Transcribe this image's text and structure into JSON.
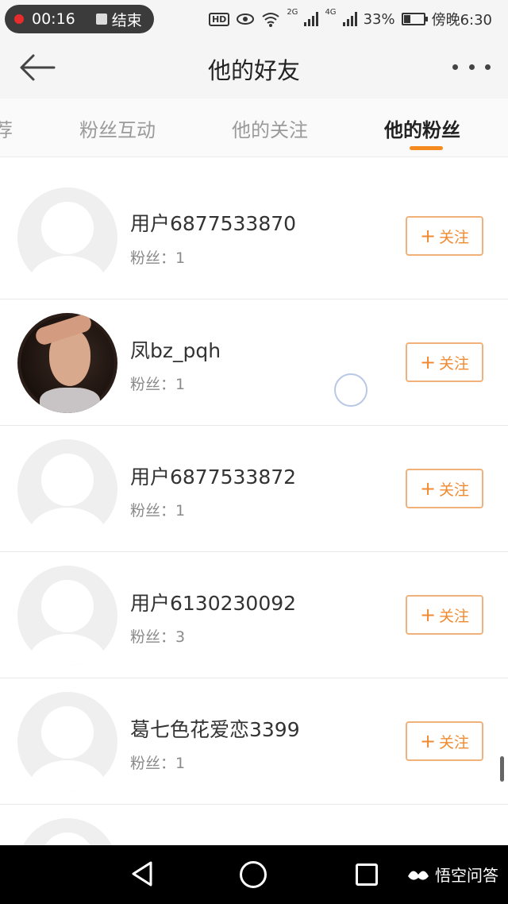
{
  "status_bar": {
    "record_time": "00:16",
    "record_end": "结束",
    "hd": "HD",
    "net_2g": "2G",
    "net_4g": "4G",
    "battery_percent": "33%",
    "battery_level": 0.33,
    "clock": "傍晚6:30"
  },
  "nav": {
    "title": "他的好友"
  },
  "tabs": [
    {
      "label": "荐",
      "active": false
    },
    {
      "label": "粉丝互动",
      "active": false
    },
    {
      "label": "他的关注",
      "active": false
    },
    {
      "label": "他的粉丝",
      "active": true
    }
  ],
  "users": [
    {
      "name": "用户6877533870",
      "fans_label": "粉丝：1",
      "avatar": "default-avatar",
      "follow_label": "关注"
    },
    {
      "name": "凤bz_pqh",
      "fans_label": "粉丝：1",
      "avatar": "photo-avatar",
      "follow_label": "关注"
    },
    {
      "name": "用户6877533872",
      "fans_label": "粉丝：1",
      "avatar": "default-avatar",
      "follow_label": "关注"
    },
    {
      "name": "用户6130230092",
      "fans_label": "粉丝：3",
      "avatar": "default-avatar",
      "follow_label": "关注"
    },
    {
      "name": "葛七色花爱恋3399",
      "fans_label": "粉丝：1",
      "avatar": "default-avatar",
      "follow_label": "关注"
    }
  ],
  "follow_plus": "+",
  "footer_brand": "悟空问答",
  "colors": {
    "accent": "#f58b1f",
    "follow_border": "#f0b27a",
    "follow_text": "#f08a30"
  }
}
